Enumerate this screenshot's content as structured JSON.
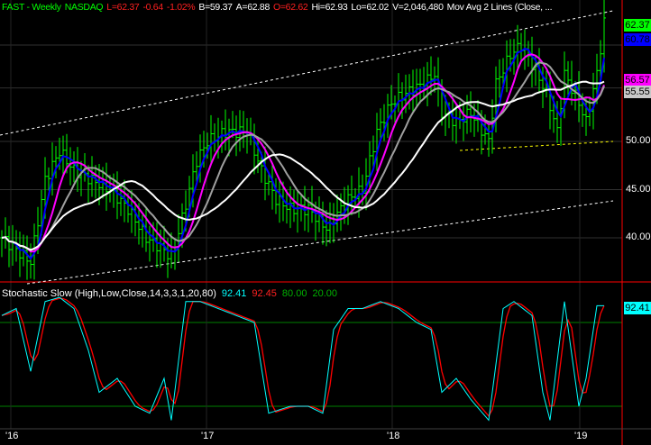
{
  "header": {
    "symbol": "FAST - Weekly",
    "exchange": "NASDAQ",
    "last": "L=62.37",
    "change": "-0.64",
    "pct": "-1.02%",
    "bid": "B=59.37",
    "ask": "A=62.88",
    "open": "O=62.62",
    "high": "Hi=62.93",
    "low": "Lo=62.02",
    "volume": "V=2,046,480",
    "study": "Mov Avg 2 Lines (Close, ..."
  },
  "stoch_header": {
    "title": "Stochastic Slow (High,Low,Close,14,3,3,1,20,80)",
    "k": "92.41",
    "d": "92.45",
    "upper": "80.00",
    "lower": "20.00"
  },
  "price_tags": [
    {
      "text": "62.37",
      "bg": "#00ff00",
      "fg": "#000"
    },
    {
      "text": "60.78",
      "bg": "#0000ff",
      "fg": "#000"
    },
    {
      "text": "56.57",
      "bg": "#ff00ff",
      "fg": "#000"
    },
    {
      "text": "55.55",
      "bg": "#c8c8c8",
      "fg": "#000"
    }
  ],
  "stoch_tag": {
    "text": "92.41",
    "bg": "#00ffff",
    "fg": "#000"
  },
  "price_axis": [
    "50.00",
    "45.00",
    "40.00"
  ],
  "x_labels": [
    "'16",
    "'17",
    "'18",
    "'19"
  ],
  "colors": {
    "bars": "#00ff00",
    "ma_blue": "#0000ff",
    "ma_magenta": "#ff00ff",
    "ma_gray": "#a0a0a0",
    "ma_white": "#ffffff",
    "k": "#00ffff",
    "d": "#ff0000",
    "channel": "#ffffff",
    "support": "#ffff00",
    "divider": "#ff0000"
  },
  "chart_data": {
    "type": "line",
    "title": "FAST - Weekly",
    "price_range": [
      37,
      64
    ],
    "price_anchors": [
      [
        0,
        40
      ],
      [
        8,
        37.5
      ],
      [
        12,
        46
      ],
      [
        16,
        49
      ],
      [
        20,
        47
      ],
      [
        25,
        46
      ],
      [
        30,
        45
      ],
      [
        35,
        43
      ],
      [
        40,
        40
      ],
      [
        44,
        39
      ],
      [
        47,
        38
      ],
      [
        50,
        42
      ],
      [
        54,
        48
      ],
      [
        57,
        50
      ],
      [
        62,
        51
      ],
      [
        68,
        51
      ],
      [
        72,
        47
      ],
      [
        76,
        44
      ],
      [
        80,
        43
      ],
      [
        85,
        43
      ],
      [
        90,
        41
      ],
      [
        92,
        42
      ],
      [
        96,
        44
      ],
      [
        100,
        45
      ],
      [
        104,
        51
      ],
      [
        108,
        54
      ],
      [
        112,
        55
      ],
      [
        117,
        56
      ],
      [
        120,
        57
      ],
      [
        122,
        53
      ],
      [
        126,
        52
      ],
      [
        130,
        53
      ],
      [
        135,
        50
      ],
      [
        137,
        56
      ],
      [
        141,
        59
      ],
      [
        144,
        60
      ],
      [
        147,
        58
      ],
      [
        151,
        55
      ],
      [
        154,
        51
      ],
      [
        156,
        57
      ],
      [
        160,
        54
      ],
      [
        162,
        52
      ],
      [
        165,
        57
      ],
      [
        167,
        62.37
      ]
    ],
    "stoch_anchors": [
      [
        0,
        85
      ],
      [
        4,
        90
      ],
      [
        8,
        45
      ],
      [
        12,
        95
      ],
      [
        16,
        98
      ],
      [
        20,
        90
      ],
      [
        24,
        60
      ],
      [
        27,
        30
      ],
      [
        32,
        40
      ],
      [
        37,
        20
      ],
      [
        41,
        15
      ],
      [
        45,
        40
      ],
      [
        47,
        10
      ],
      [
        51,
        95
      ],
      [
        55,
        95
      ],
      [
        60,
        90
      ],
      [
        65,
        85
      ],
      [
        70,
        80
      ],
      [
        74,
        15
      ],
      [
        80,
        20
      ],
      [
        85,
        20
      ],
      [
        89,
        15
      ],
      [
        92,
        75
      ],
      [
        96,
        90
      ],
      [
        100,
        90
      ],
      [
        105,
        95
      ],
      [
        110,
        90
      ],
      [
        115,
        80
      ],
      [
        119,
        75
      ],
      [
        122,
        30
      ],
      [
        126,
        40
      ],
      [
        130,
        25
      ],
      [
        135,
        10
      ],
      [
        139,
        90
      ],
      [
        142,
        95
      ],
      [
        147,
        85
      ],
      [
        150,
        30
      ],
      [
        152,
        10
      ],
      [
        156,
        95
      ],
      [
        160,
        20
      ],
      [
        162,
        40
      ],
      [
        165,
        92
      ]
    ],
    "stoch_levels": [
      80,
      20
    ],
    "x_ticks": [
      "'16",
      "'17",
      "'18",
      "'19"
    ]
  }
}
